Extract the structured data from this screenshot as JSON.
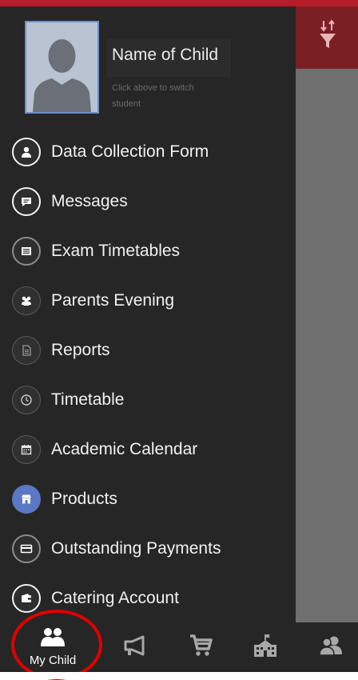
{
  "profile": {
    "child_name": "Name of Child",
    "switch_hint": "Click above to switch student"
  },
  "menu": [
    {
      "label": "Data Collection Form",
      "icon": "person-icon"
    },
    {
      "label": "Messages",
      "icon": "chat-bubble-icon"
    },
    {
      "label": "Exam Timetables",
      "icon": "list-icon"
    },
    {
      "label": "Parents Evening",
      "icon": "group-icon"
    },
    {
      "label": "Reports",
      "icon": "document-icon"
    },
    {
      "label": "Timetable",
      "icon": "clock-icon"
    },
    {
      "label": "Academic Calendar",
      "icon": "calendar-icon"
    },
    {
      "label": "Products",
      "icon": "store-icon"
    },
    {
      "label": "Outstanding Payments",
      "icon": "credit-card-icon"
    },
    {
      "label": "Catering Account",
      "icon": "wallet-icon"
    }
  ],
  "bottom_nav": {
    "my_child_label": "My Child",
    "items": [
      "my-child-icon",
      "megaphone-icon",
      "cart-icon",
      "school-icon",
      "contacts-icon"
    ]
  },
  "colors": {
    "drawer_bg": "#262626",
    "header_red": "#b71c2a",
    "products_accent": "#5b77c6",
    "highlight_circle": "#e00000"
  }
}
